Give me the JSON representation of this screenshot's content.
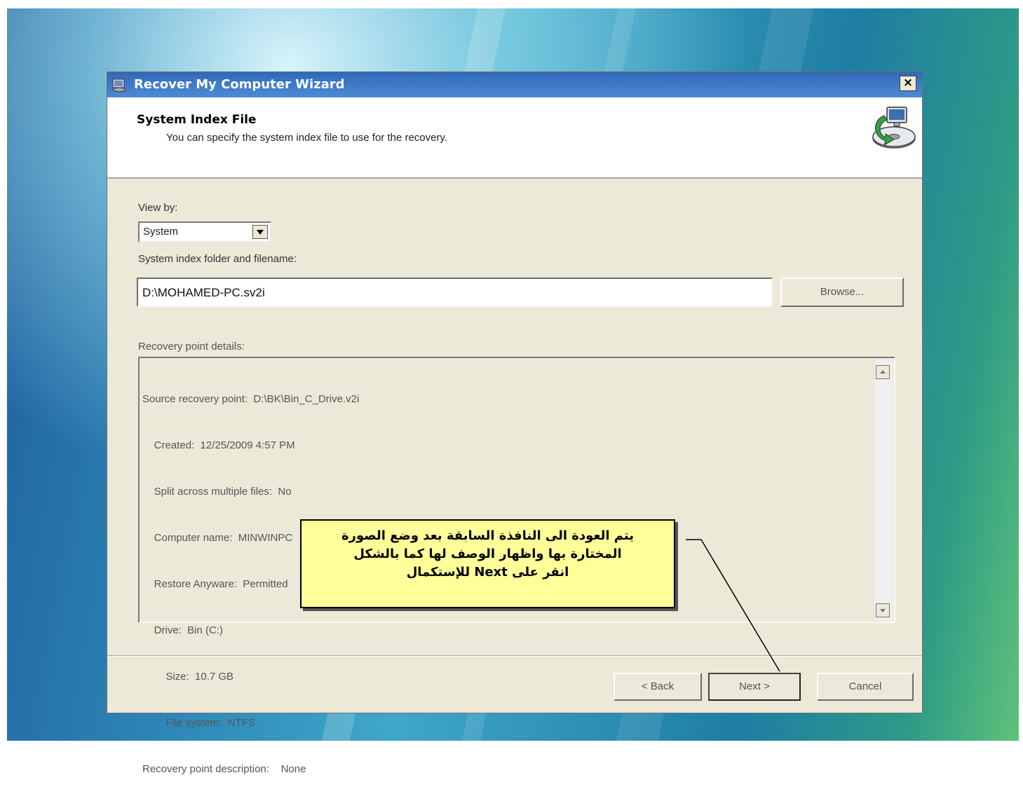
{
  "window": {
    "title": "Recover My Computer Wizard",
    "close_label": "×"
  },
  "header": {
    "title": "System Index File",
    "subtitle": "You can specify the system index file to use for the recovery."
  },
  "form": {
    "view_by_label": "View by:",
    "view_by_value": "System",
    "index_label": "System index folder and filename:",
    "index_value": "D:\\MOHAMED-PC.sv2i",
    "browse_label": "Browse..."
  },
  "details": {
    "label": "Recovery point details:",
    "lines": [
      "Source recovery point:  D:\\BK\\Bin_C_Drive.v2i",
      "    Created:  12/25/2009 4:57 PM",
      "    Split across multiple files:  No",
      "    Computer name:  MINWINPC",
      "    Restore Anyware:  Permitted",
      "    Drive:  Bin (C:)",
      "        Size:  10.7 GB",
      "        File system:  NTFS",
      "Recovery point description:    None"
    ]
  },
  "buttons": {
    "back": "< Back",
    "next": "Next >",
    "cancel": "Cancel"
  },
  "callout": {
    "line1": "يتم العودة الى النافذة السابقة بعد وضع الصورة",
    "line2": "المختارة بها واظهار الوصف لها كما بالشكل",
    "line3": "انقر على  Next للإستكمال"
  },
  "icons": {
    "title_icon": "wizard-icon",
    "header_icon": "computer-recovery-icon"
  }
}
